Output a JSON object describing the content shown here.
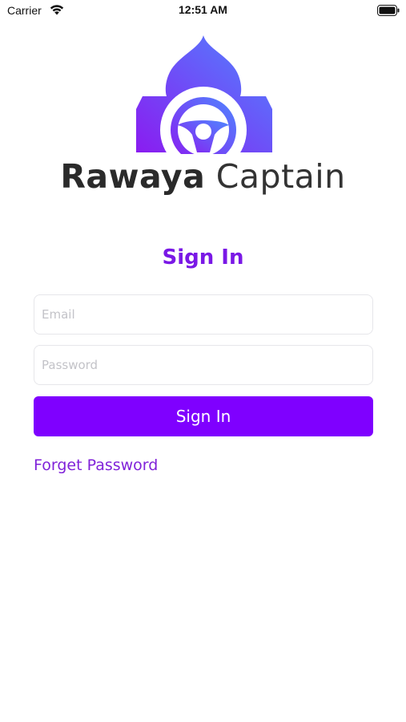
{
  "status_bar": {
    "carrier": "Carrier",
    "time": "12:51 AM",
    "icons": [
      "wifi-icon",
      "battery-icon"
    ]
  },
  "logo": {
    "icon": "mosque-steering-wheel-logo",
    "name_bold": "Rawaya",
    "name_light": " Captain",
    "gradient_colors": [
      "#8a1cf0",
      "#4f86ff"
    ]
  },
  "form": {
    "title": "Sign In",
    "email_placeholder": "Email",
    "password_placeholder": "Password",
    "submit_label": "Sign In",
    "forget_password_label": "Forget Password"
  },
  "colors": {
    "accent": "#7f00ff",
    "title": "#7a18e6",
    "link": "#8022d9"
  }
}
